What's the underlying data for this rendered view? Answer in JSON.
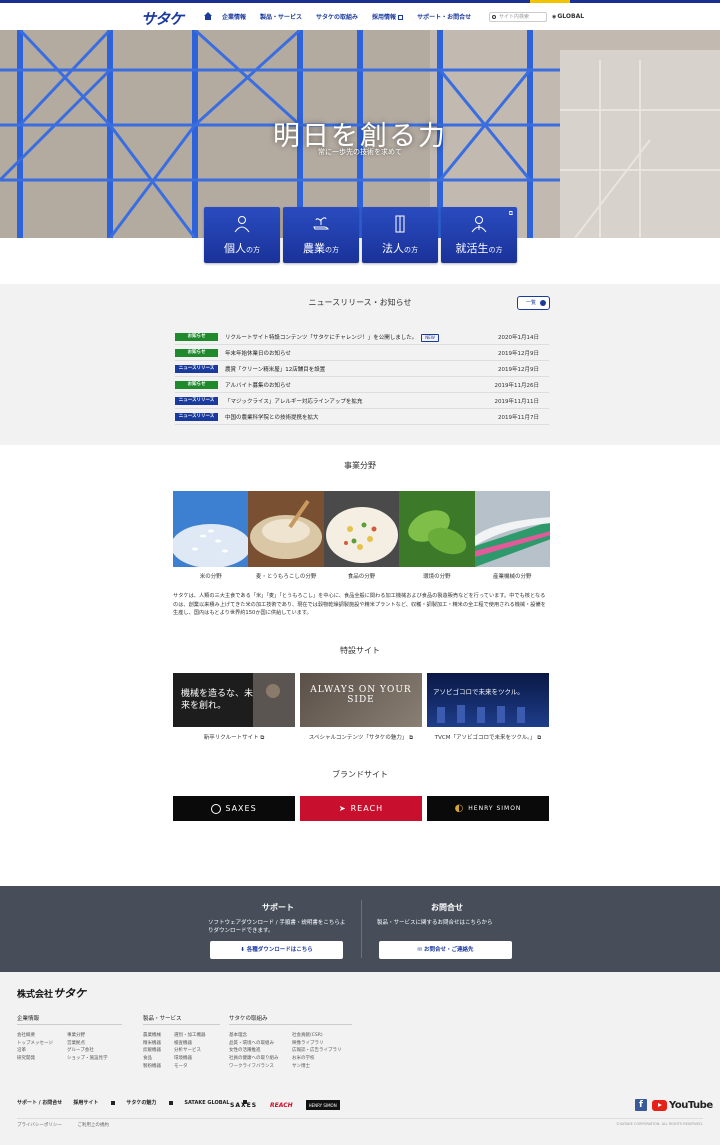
{
  "header": {
    "logo": "サタケ",
    "nav": [
      {
        "label": "企業情報",
        "ext": false
      },
      {
        "label": "製品・サービス",
        "ext": false
      },
      {
        "label": "サタケの取組み",
        "ext": false
      },
      {
        "label": "採用情報",
        "ext": true
      },
      {
        "label": "サポート・お問合せ",
        "ext": false
      }
    ],
    "search_placeholder": "サイト内検索",
    "global_label": "GLOBAL"
  },
  "hero": {
    "title": "明日を創る力",
    "subtitle": "常に一歩先の技術を求めて"
  },
  "categories": [
    {
      "main": "個人",
      "suffix": "の方",
      "icon": "person-icon",
      "ext": false
    },
    {
      "main": "農業",
      "suffix": "の方",
      "icon": "seedling-hand-icon",
      "ext": false
    },
    {
      "main": "法人",
      "suffix": "の方",
      "icon": "building-icon",
      "ext": false
    },
    {
      "main": "就活生",
      "suffix": "の方",
      "icon": "student-icon",
      "ext": true
    }
  ],
  "news": {
    "title": "ニュースリリース・お知らせ",
    "more_label": "一覧",
    "items": [
      {
        "tag": "お知らせ",
        "tag_color": "green",
        "text": "リクルートサイト特設コンテンツ「サタケにチャレンジ！」を公開しました。",
        "new": "NEW",
        "date": "2020年1月14日"
      },
      {
        "tag": "お知らせ",
        "tag_color": "green",
        "text": "年末年始休業日のお知らせ",
        "new": "",
        "date": "2019年12月9日"
      },
      {
        "tag": "ニュースリリース",
        "tag_color": "blue",
        "text": "農賞「クリーン精米屋」12店舗目を設置",
        "new": "",
        "date": "2019年12月9日"
      },
      {
        "tag": "お知らせ",
        "tag_color": "green",
        "text": "アルバイト募集のお知らせ",
        "new": "",
        "date": "2019年11月26日"
      },
      {
        "tag": "ニュースリリース",
        "tag_color": "blue",
        "text": "「マジックライス」アレルギー対応ラインアップを拡充",
        "new": "",
        "date": "2019年11月11日"
      },
      {
        "tag": "ニュースリリース",
        "tag_color": "blue",
        "text": "中国の農業科学院との技術提携を拡大",
        "new": "",
        "date": "2019年11月7日"
      }
    ]
  },
  "business": {
    "title": "事業分野",
    "items": [
      "米の分野",
      "麦・とうもろこしの分野",
      "食品の分野",
      "環境の分野",
      "産業機械の分野"
    ],
    "description": "サタケは、人類の三大主食である「米」「麦」「とうもろこし」を中心に、食品全般に関わる加工機械および食品の製造販売などを行っています。中でも核となるのは、創業以来積み上げてきた米の加工技術であり、現在では穀物乾燥調製施設や精米プラントなど、収穫・調製加工・精米の全工程で使用される機械・設備を生産し、国内はもとより世界約150か国に供給しています。"
  },
  "special": {
    "title": "特設サイト",
    "items": [
      {
        "caption": "新卒リクルートサイト",
        "banner": "機械を造るな、未来を創れ。"
      },
      {
        "caption": "スペシャルコンテンツ「サタケの魅力」",
        "banner": "ALWAYS ON YOUR SIDE"
      },
      {
        "caption": "TVCM「アソビゴコロで未来をツクル。」",
        "banner": "アソビゴコロで未来をツクル。"
      }
    ]
  },
  "brand": {
    "title": "ブランドサイト",
    "items": [
      {
        "name": "SAXES",
        "bg": "#0a0a0a"
      },
      {
        "name": "REACH",
        "bg": "#c8102e"
      },
      {
        "name": "HENRY SIMON",
        "bg": "#0a0a0a"
      }
    ]
  },
  "support": {
    "left": {
      "title": "サポート",
      "text": "ソフトウェアダウンロード / 手順書・説明書をこちらよりダウンロードできます。",
      "button": "各種ダウンロードはこちら"
    },
    "right": {
      "title": "お問合せ",
      "text": "製品・サービスに関するお問合せはこちらから",
      "button": "お問合せ・ご連絡先"
    }
  },
  "footer": {
    "logo_prefix": "株式会社",
    "logo_name": "サタケ",
    "columns": [
      {
        "title": "企業情報",
        "links_a": [
          "会社概要",
          "トップメッセージ",
          "沿革",
          "研究開発"
        ],
        "links_b": [
          "事業分野",
          "営業拠点",
          "グループ会社",
          "ショップ・施設見学"
        ]
      },
      {
        "title": "製品・サービス",
        "links_a": [
          "農業機械",
          "精米機器",
          "炊飯機器",
          "食品",
          "製粉機器"
        ],
        "links_b": [
          "選別・加工機器",
          "検査機器",
          "分析サービス",
          "環境機器",
          "モータ"
        ]
      },
      {
        "title": "サタケの取組み",
        "links_a": [
          "基本理念",
          "品質・環境への取組み",
          "女性の活躍推進",
          "社員の健康への取り組み",
          "ワークライフバランス"
        ],
        "links_b": [
          "社会貢献(CSR)",
          "映像ライブラリ",
          "広報誌・広告ライブラリ",
          "お米の学校",
          "サン博士"
        ]
      }
    ],
    "bottom_links": [
      {
        "label": "サポート / お問合せ",
        "ext": false
      },
      {
        "label": "採用サイト",
        "ext": true
      },
      {
        "label": "サタケの魅力",
        "ext": true
      },
      {
        "label": "SATAKE GLOBAL",
        "ext": true
      }
    ],
    "brand_logos": [
      "SAXES",
      "REACH",
      "HENRY SIMON"
    ],
    "social": {
      "facebook": "f",
      "youtube": "YouTube"
    },
    "policy_links": [
      "プライバシーポリシー",
      "ご利用上の規約"
    ],
    "copyright": "©SATAKE CORPORATION. ALL RIGHTS RESERVED."
  }
}
